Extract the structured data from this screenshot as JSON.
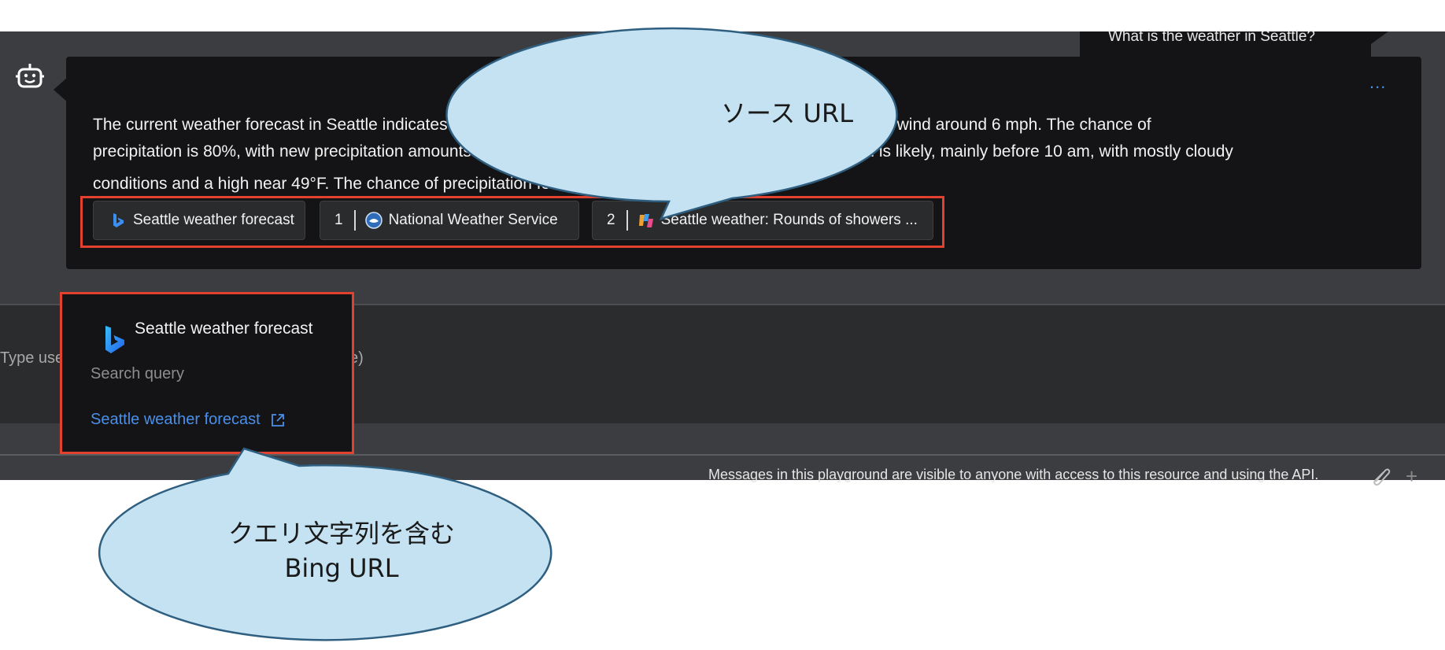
{
  "user_message": "What is the weather in Seattle?",
  "answer": {
    "line1": "The current weather forecast in Seattle indicates that the area will see rain, with a high near 47°F and a south wind around 6 mph. The chance of",
    "line2": "precipitation is 80%, with new precipitation amounts of less than a tenth of an inch possible. On Friday, rain is likely, mainly before 10 am, with mostly cloudy",
    "line3": "conditions and a high near 49°F. The chance of precipitation for Friday is 60%",
    "citations": "1 2"
  },
  "more_button": "...",
  "sources": [
    {
      "label": "Seattle weather forecast",
      "icon": "bing-icon"
    },
    {
      "number": "1",
      "label": "National Weather Service",
      "icon": "nws-icon"
    },
    {
      "number": "2",
      "label": "Seattle weather: Rounds of showers ...",
      "icon": "news-icon"
    }
  ],
  "input": {
    "placeholder_left": "Type use",
    "placeholder_right": "e)"
  },
  "footer": {
    "text": "Messages in this playground are visible to anyone with access to this resource and using the API."
  },
  "popup": {
    "title": "Seattle weather forecast",
    "subtitle": "Search query",
    "link": "Seattle weather forecast"
  },
  "callouts": {
    "source_url": "ソース URL",
    "bing_url_line1": "クエリ文字列を含む",
    "bing_url_line2": "Bing URL"
  },
  "colors": {
    "accent_link": "#4a8fe8",
    "highlight_border": "#e2412f",
    "callout_fill": "#c5e2f2",
    "callout_stroke": "#2f5f80"
  }
}
